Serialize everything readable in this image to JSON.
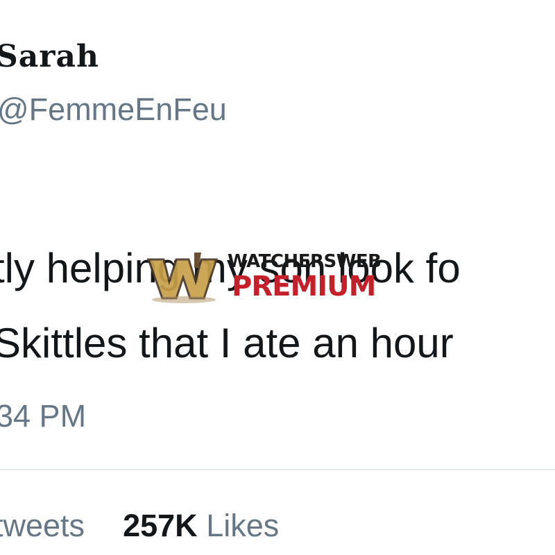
{
  "tweet": {
    "display_name": "Sarah",
    "handle": "@FemmeEnFeu",
    "text_lines": [
      "tly helping my son look fo",
      "Skittles that I ate an hour"
    ],
    "timestamp": "34 PM",
    "stats": {
      "retweets_label": "tweets",
      "likes_count": "257K",
      "likes_label": "Likes"
    }
  },
  "watermark": {
    "line1": "WATCHERSWEB",
    "line2": "PREMIUM",
    "colors": {
      "brand_red": "#c4202a",
      "logo_gold": "#c8a04a",
      "logo_dark": "#4a3a2a"
    }
  },
  "colors": {
    "text_primary": "#14171a",
    "text_secondary": "#657786",
    "divider": "#e6ecf0"
  }
}
